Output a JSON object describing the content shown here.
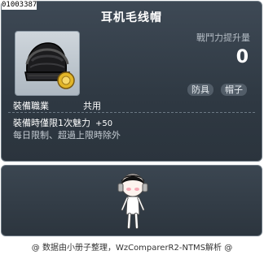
{
  "item_id": "01003387",
  "item": {
    "name": "耳机毛线帽",
    "icon": "headphone-beanie-icon",
    "power_label": "戰鬥力提升量",
    "power_value": "0",
    "tags": [
      "防具",
      "帽子"
    ],
    "job_label": "裝備職業",
    "job_value": "共用",
    "stat_line": "裝備時僅限1次魅力",
    "stat_bonus": "+50",
    "restriction": "每日限制、超過上限時除外"
  },
  "preview": {
    "icon": "character-preview-icon"
  },
  "credit": "@ 数据由小册子整理，WzComparerR2-NTMS解析 @",
  "colors": {
    "panel_bg": "#2f3943",
    "panel_border": "#6e7a84",
    "tag_bg": "#525d68",
    "title": "#ffffff"
  }
}
